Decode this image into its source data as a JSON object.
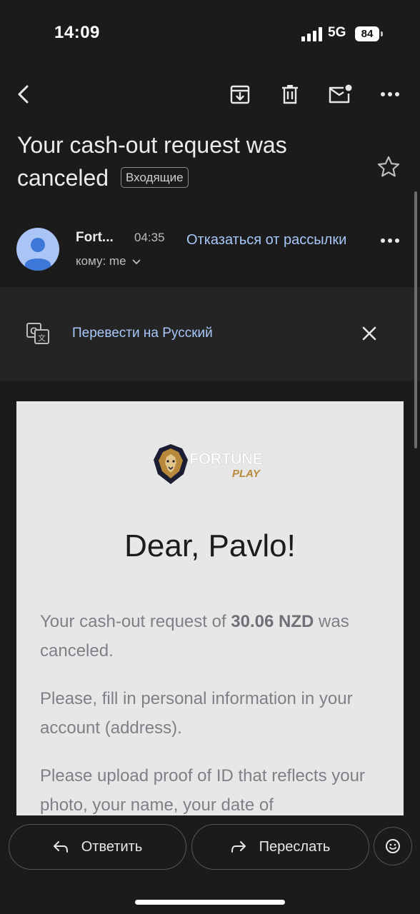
{
  "status_bar": {
    "time": "14:09",
    "network": "5G",
    "battery": "84"
  },
  "toolbar": {
    "icons": [
      "back-arrow-icon",
      "archive-icon",
      "trash-icon",
      "mark-unread-icon",
      "more-icon"
    ]
  },
  "email": {
    "subject": "Your cash-out request was canceled",
    "label": "Входящие",
    "sender_name": "Fort...",
    "time": "04:35",
    "unsubscribe_label": "Отказаться от рассылки",
    "to_prefix": "кому:",
    "to_value": "me"
  },
  "translate_bar": {
    "label": "Перевести на Русский"
  },
  "message": {
    "logo_alt": "FORTUNE PLAY",
    "greeting": "Dear, Pavlo!",
    "para1_before": "Your cash-out request of ",
    "para1_amount": "30.06 NZD",
    "para1_after": " was canceled.",
    "para2": "Please, fill in personal information in your account (address).",
    "para3": "Please upload proof of ID that reflects your photo, your name, your date of"
  },
  "actions": {
    "reply_label": "Ответить",
    "forward_label": "Переслать"
  },
  "colors": {
    "background": "#1b1b1b",
    "link": "#a8c7fa",
    "card": "#e7e7e7",
    "avatar": "#a9c4f5"
  }
}
